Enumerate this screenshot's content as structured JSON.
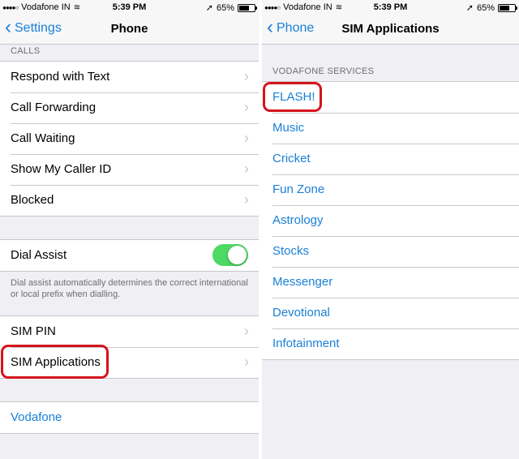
{
  "left_screen": {
    "status": {
      "carrier": "Vodafone IN",
      "time": "5:39 PM",
      "battery": "65%",
      "battery_level": 0.65
    },
    "nav": {
      "back_label": "Settings",
      "title": "Phone"
    },
    "calls_header": "CALLS",
    "calls_items": [
      "Respond with Text",
      "Call Forwarding",
      "Call Waiting",
      "Show My Caller ID",
      "Blocked"
    ],
    "dial_assist": {
      "label": "Dial Assist",
      "enabled": true,
      "footnote": "Dial assist automatically determines the correct international or local prefix when dialling."
    },
    "sim_items": [
      "SIM PIN",
      "SIM Applications"
    ],
    "carrier_link": "Vodafone"
  },
  "right_screen": {
    "status": {
      "carrier": "Vodafone IN",
      "time": "5:39 PM",
      "battery": "65%",
      "battery_level": 0.65
    },
    "nav": {
      "back_label": "Phone",
      "title": "SIM Applications"
    },
    "section_header": "VODAFONE SERVICES",
    "items": [
      "FLASH!",
      "Music",
      "Cricket",
      "Fun Zone",
      "Astrology",
      "Stocks",
      "Messenger",
      "Devotional",
      "Infotainment"
    ]
  },
  "colors": {
    "accent": "#1a7fd7",
    "toggle_on": "#4cd964",
    "highlight": "#d5141b"
  }
}
